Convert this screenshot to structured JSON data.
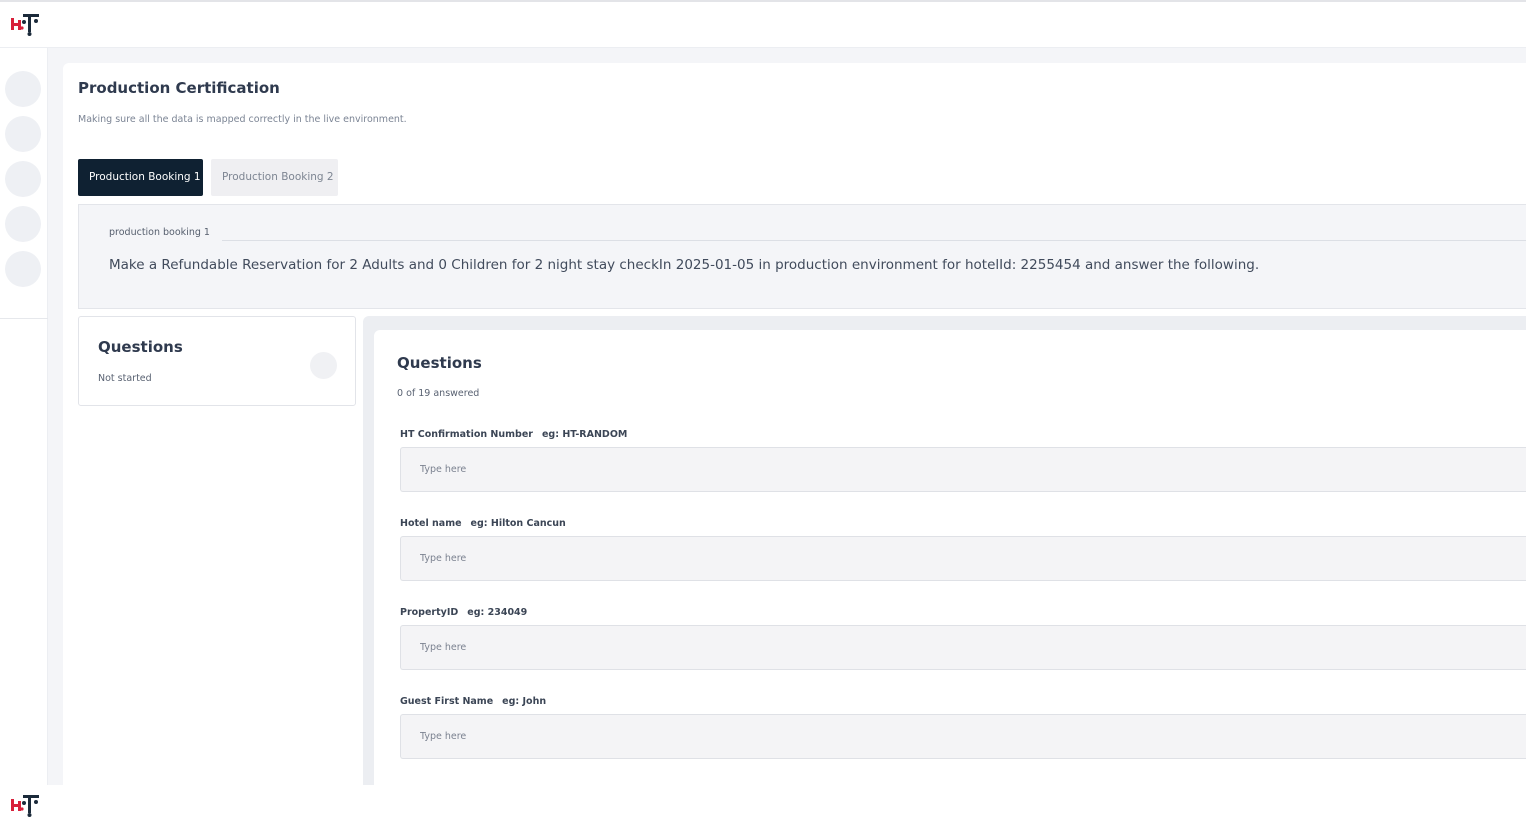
{
  "header": {
    "logo": "hotel-logo"
  },
  "page": {
    "title": "Production Certification",
    "subtitle": "Making sure all the data is mapped correctly in the live environment."
  },
  "tabs": [
    {
      "label": "Production Booking 1",
      "active": true
    },
    {
      "label": "Production Booking 2",
      "active": false
    }
  ],
  "booking": {
    "label": "production booking 1",
    "instruction": "Make a Refundable Reservation for 2 Adults and 0 Children for 2 night stay checkIn 2025-01-05 in production environment for hotelId: 2255454 and answer the following."
  },
  "sidebar_card": {
    "title": "Questions",
    "status": "Not started"
  },
  "questions": {
    "title": "Questions",
    "progress": "0 of 19 answered",
    "fields": [
      {
        "label": "HT Confirmation Number",
        "example": "eg: HT-RANDOM",
        "placeholder": "Type here",
        "value": ""
      },
      {
        "label": "Hotel name",
        "example": "eg: Hilton Cancun",
        "placeholder": "Type here",
        "value": ""
      },
      {
        "label": "PropertyID",
        "example": "eg: 234049",
        "placeholder": "Type here",
        "value": ""
      },
      {
        "label": "Guest First Name",
        "example": "eg: John",
        "placeholder": "Type here",
        "value": ""
      }
    ]
  },
  "colors": {
    "accent_dark": "#0f2132",
    "logo_red": "#d8203a",
    "logo_dark": "#1b2a3a"
  }
}
